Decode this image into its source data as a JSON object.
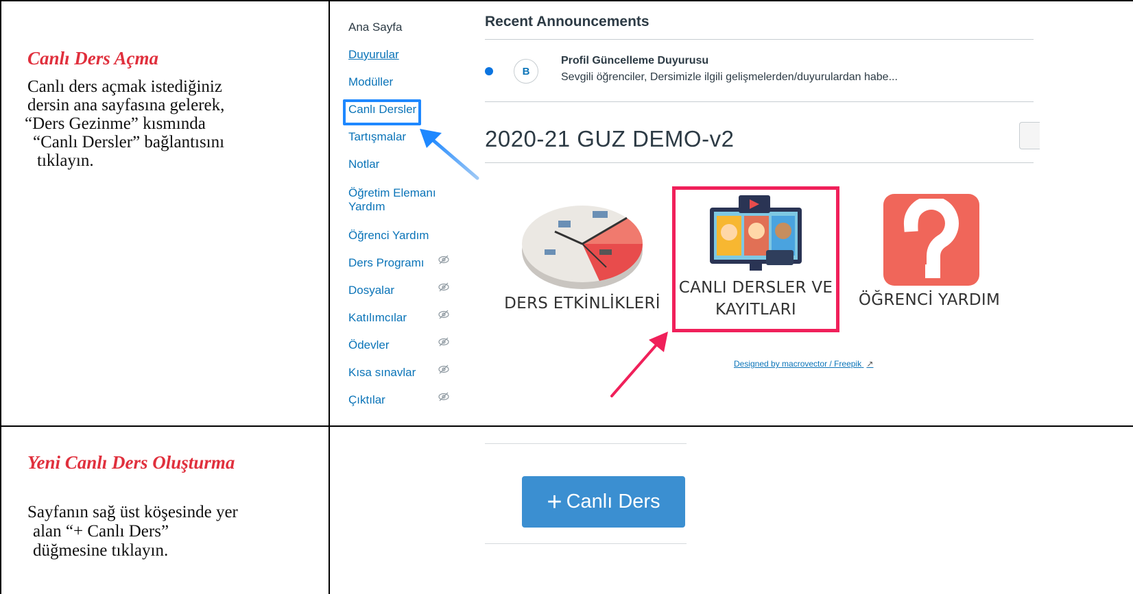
{
  "step1": {
    "title": "Canlı Ders Açma",
    "lines": [
      "Canlı ders açmak istediğiniz",
      "dersin ana sayfasına gelerek,",
      "“Ders Gezinme” kısmında",
      "“Canlı Dersler” bağlantısını",
      "tıklayın."
    ]
  },
  "step2": {
    "title": "Yeni Canlı Ders Oluşturma",
    "lines": [
      "Sayfanın sağ üst köşesinde yer",
      "alan “+ Canlı Ders”",
      "düğmesine tıklayın."
    ]
  },
  "nav": {
    "items": [
      {
        "label": "Ana Sayfa",
        "hidden": false
      },
      {
        "label": "Duyurular",
        "hidden": false
      },
      {
        "label": "Modüller",
        "hidden": false
      },
      {
        "label": "Canlı Dersler",
        "hidden": false
      },
      {
        "label": "Tartışmalar",
        "hidden": false
      },
      {
        "label": "Notlar",
        "hidden": false
      },
      {
        "label": "Öğretim Elemanı",
        "label2": "Yardım",
        "hidden": false
      },
      {
        "label": "Öğrenci Yardım",
        "hidden": false
      },
      {
        "label": "Ders Programı",
        "hidden": true,
        "icon": "eye-slash-icon"
      },
      {
        "label": "Dosyalar",
        "hidden": true,
        "icon": "eye-slash-icon"
      },
      {
        "label": "Katılımcılar",
        "hidden": true,
        "icon": "eye-slash-icon"
      },
      {
        "label": "Ödevler",
        "hidden": true,
        "icon": "eye-slash-icon"
      },
      {
        "label": "Kısa sınavlar",
        "hidden": true,
        "icon": "eye-slash-icon"
      },
      {
        "label": "Çıktılar",
        "hidden": true,
        "icon": "eye-slash-icon"
      }
    ]
  },
  "announcements": {
    "title": "Recent Announcements",
    "item": {
      "avatar": "B",
      "title": "Profil Güncelleme Duyurusu",
      "body": "Sevgili öğrenciler, Dersimizle ilgili gelişmelerden/duyurulardan habe..."
    }
  },
  "course": {
    "title": "2020-21 GUZ DEMO-v2"
  },
  "tiles": [
    {
      "label": "DERS ETKİNLİKLERİ",
      "icon": "clock-office-icon"
    },
    {
      "label": "CANLI DERSLER VE",
      "label2": "KAYITLARI",
      "icon": "video-conference-icon"
    },
    {
      "label": "ÖĞRENCİ YARDIM",
      "icon": "question-icon"
    }
  ],
  "credit": "Designed by macrovector / Freepik",
  "live_button": {
    "plus": "+",
    "label": "Canlı Ders"
  },
  "colors": {
    "accent_red": "#e0303d",
    "highlight_blue": "#1e88ff",
    "highlight_pink": "#f0205a",
    "link": "#0b74b8",
    "button": "#3b8fd1"
  }
}
